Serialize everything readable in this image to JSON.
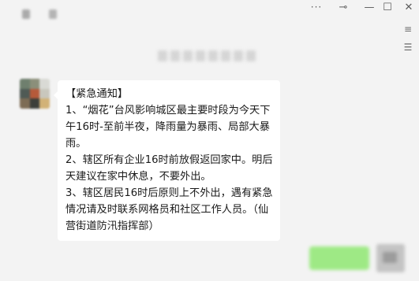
{
  "window": {
    "controls": {
      "more": "···",
      "pin": "⊸",
      "minimize": "—",
      "maximize": "☐",
      "close": "✕"
    },
    "side_icons": [
      "≡",
      "☰"
    ]
  },
  "message": {
    "lines": [
      "【紧急通知】",
      "1、“烟花”台风影响城区最主要时段为今天下午16时-至前半夜，降雨量为暴雨、局部大暴雨。",
      "2、辖区所有企业16时前放假返回家中。明后天建议在家中休息，不要外出。",
      "3、辖区居民16时后原则上不外出，遇有紧急情况请及时联系网格员和社区工作人员。（仙营街道防汛指挥部）"
    ]
  },
  "colors": {
    "background": "#f3f3f3",
    "bubble": "#ffffff",
    "outgoing_bubble": "#95e97a"
  }
}
